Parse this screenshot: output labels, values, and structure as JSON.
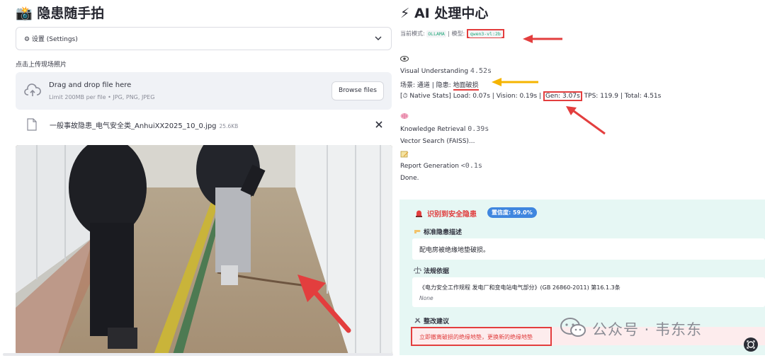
{
  "left": {
    "title": "📸 隐患随手拍",
    "settings_label": "⚙ 设置 (Settings)",
    "upload_label": "点击上传现场照片",
    "dropzone": {
      "title": "Drag and drop file here",
      "hint": "Limit 200MB per file • JPG, PNG, JPEG",
      "browse_label": "Browse files"
    },
    "file": {
      "name": "一般事故隐患_电气安全类_AnhuiXX2025_10_0.jpg",
      "size": "25.6KB"
    }
  },
  "right": {
    "title": "⚡ AI 处理中心",
    "mode_label": "当前模式:",
    "mode_value": "OLLAMA",
    "model_label": "| 模型:",
    "model_value": "qwen3-vl:2b",
    "visual_label": "Visual Understanding",
    "visual_time": "4.52s",
    "scene_prefix": "场景: 通道 | 隐患: ",
    "scene_hazard": "地面破损",
    "stats_prefix": "[⏱ Native Stats] Load: 0.07s | Vision: 0.19s | ",
    "stats_gen": "Gen: 3.07s",
    "stats_suffix": " TPS: 119.9 | Total: 4.51s",
    "kr_label": "Knowledge Retrieval",
    "kr_time": "0.39s",
    "vector_search": "Vector Search (FAISS)...",
    "report_label": "Report Generation",
    "report_time": "<0.1s",
    "done": "Done."
  },
  "result": {
    "title": "识别到安全隐患",
    "confidence": "置信度: 59.0%",
    "desc_heading": "标准隐患描述",
    "desc_text": "配电房被绝缘地垫破损。",
    "law_heading": "法规依据",
    "law_text": "《电力安全工作规程 发电厂和变电站电气部分》(GB 26860-2011) 第16.1.3条",
    "law_note": "None",
    "fix_heading": "整改建议",
    "fix_text": "立即撤离破损的绝缘地垫，更换新的绝缘地垫"
  },
  "watermark": "公众号 · 韦东东",
  "colors": {
    "annotation_red": "#e33e3e",
    "annotation_yellow": "#f5b400",
    "badge_blue": "#3f86df",
    "result_bg": "#e6f7f4",
    "code_green": "#21a87a"
  }
}
